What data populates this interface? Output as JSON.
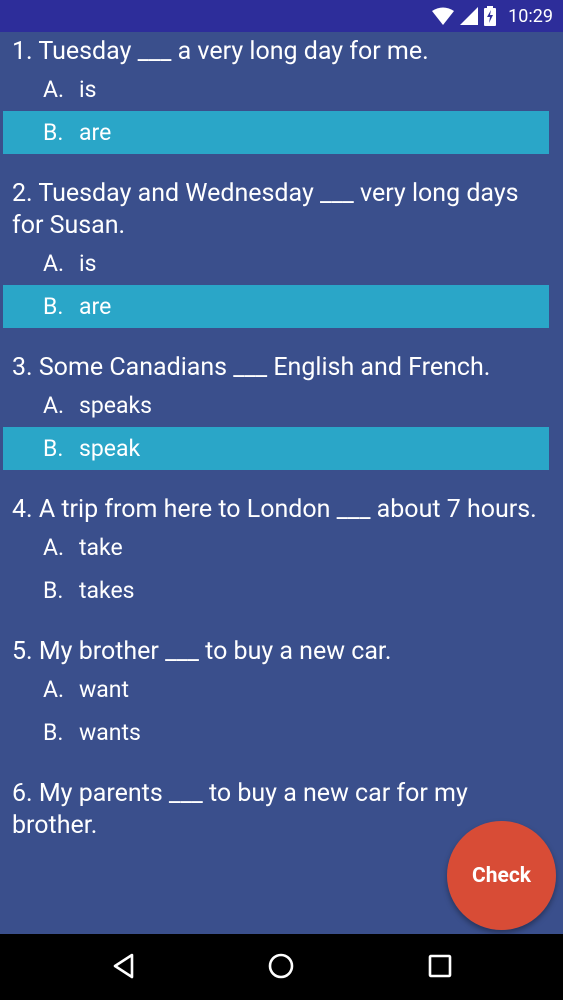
{
  "status_bar": {
    "time": "10:29",
    "icons": [
      "wifi-icon",
      "signal-icon",
      "battery-icon"
    ]
  },
  "questions": [
    {
      "text": "1. Tuesday ___ a very long day for me.",
      "options": [
        {
          "letter": "A.",
          "text": "is",
          "selected": false
        },
        {
          "letter": "B.",
          "text": "are",
          "selected": true
        }
      ]
    },
    {
      "text": "2. Tuesday and Wednesday ___ very long days for Susan.",
      "options": [
        {
          "letter": "A.",
          "text": "is",
          "selected": false
        },
        {
          "letter": "B.",
          "text": "are",
          "selected": true
        }
      ]
    },
    {
      "text": "3. Some Canadians ___ English and French.",
      "options": [
        {
          "letter": "A.",
          "text": "speaks",
          "selected": false
        },
        {
          "letter": "B.",
          "text": "speak",
          "selected": true
        }
      ]
    },
    {
      "text": "4. A trip from here to London ___ about 7 hours.",
      "options": [
        {
          "letter": "A.",
          "text": "take",
          "selected": false
        },
        {
          "letter": "B.",
          "text": "takes",
          "selected": false
        }
      ]
    },
    {
      "text": "5. My brother ___ to buy a new car.",
      "options": [
        {
          "letter": "A.",
          "text": "want",
          "selected": false
        },
        {
          "letter": "B.",
          "text": "wants",
          "selected": false
        }
      ]
    },
    {
      "text": "6. My parents ___ to buy a new car for my brother.",
      "options": []
    }
  ],
  "fab": {
    "label": "Check"
  },
  "nav_bar": {
    "icons": [
      "back-icon",
      "home-icon",
      "recents-icon"
    ]
  },
  "colors": {
    "background": "#3a4f8c",
    "selected": "#2aa6c8",
    "status_bar": "#2d2d9a",
    "fab": "#dd4c34"
  }
}
